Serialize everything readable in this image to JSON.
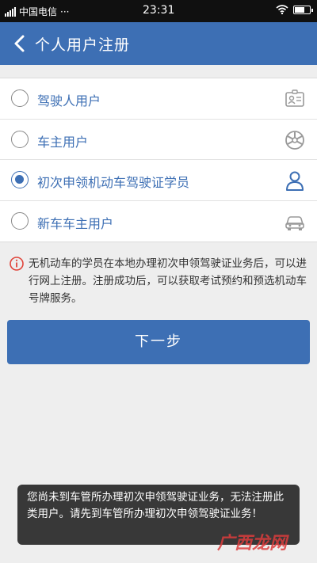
{
  "status": {
    "carrier": "中国电信",
    "time": "23:31"
  },
  "header": {
    "title": "个人用户注册"
  },
  "options": [
    {
      "label": "驾驶人用户",
      "icon": "id-card-icon",
      "selected": false
    },
    {
      "label": "车主用户",
      "icon": "wheel-icon",
      "selected": false
    },
    {
      "label": "初次申领机动车驾驶证学员",
      "icon": "person-icon",
      "selected": true
    },
    {
      "label": "新车车主用户",
      "icon": "car-icon",
      "selected": false
    }
  ],
  "notice": {
    "text": "无机动车的学员在本地办理初次申领驾驶证业务后，可以进行网上注册。注册成功后，可以获取考试预约和预选机动车号牌服务。"
  },
  "actions": {
    "next_label": "下一步"
  },
  "toast": {
    "text": "您尚未到车管所办理初次申领驾驶证业务，无法注册此类用户。请先到车管所办理初次申领驾驶证业务！"
  },
  "watermark": "广西龙网",
  "colors": {
    "accent": "#3d6fb4",
    "background": "#eeeeee",
    "toast": "#282828"
  }
}
